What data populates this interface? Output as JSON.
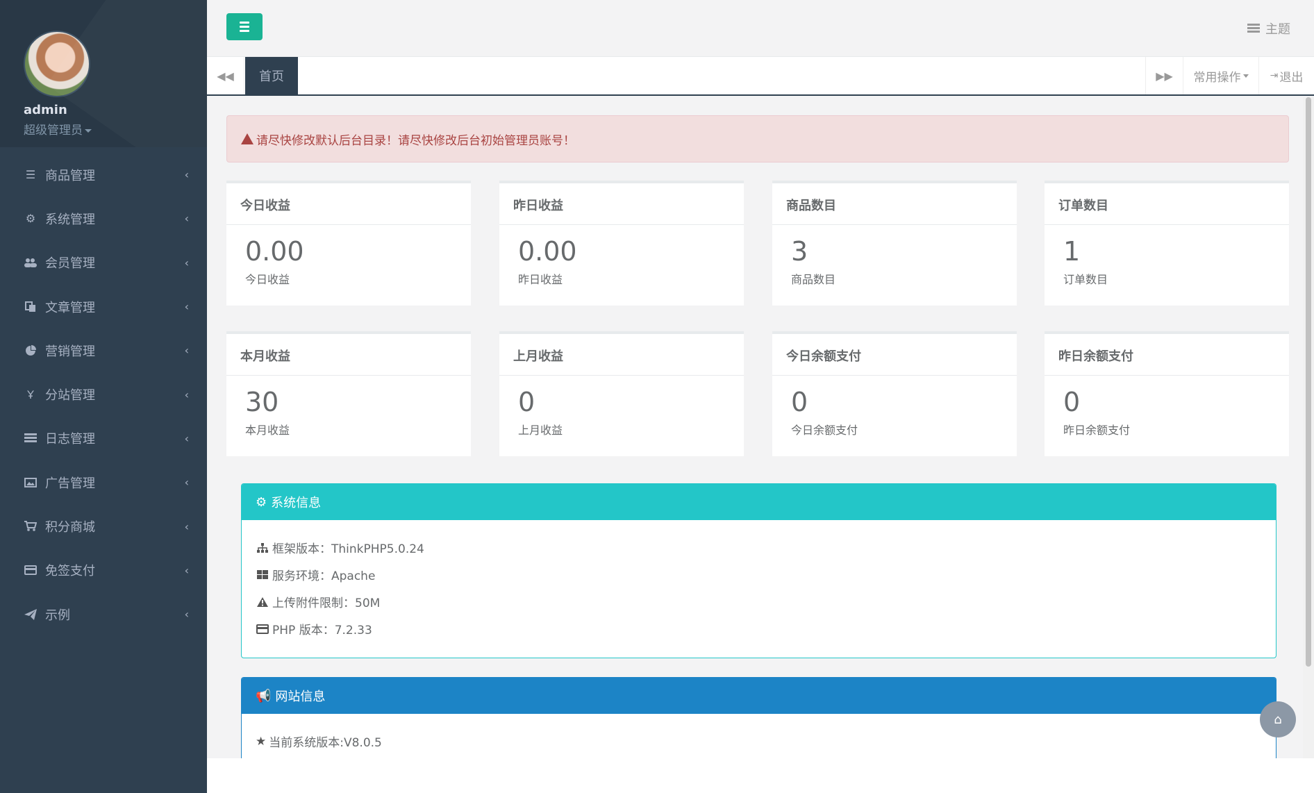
{
  "profile": {
    "name": "admin",
    "role": "超级管理员"
  },
  "sidebar": {
    "items": [
      {
        "label": "商品管理",
        "icon": "list-icon"
      },
      {
        "label": "系统管理",
        "icon": "gear-icon"
      },
      {
        "label": "会员管理",
        "icon": "users-icon"
      },
      {
        "label": "文章管理",
        "icon": "copy-icon"
      },
      {
        "label": "营销管理",
        "icon": "pie-chart-icon"
      },
      {
        "label": "分站管理",
        "icon": "tree-icon"
      },
      {
        "label": "日志管理",
        "icon": "tasks-icon"
      },
      {
        "label": "广告管理",
        "icon": "picture-icon"
      },
      {
        "label": "积分商城",
        "icon": "cart-icon"
      },
      {
        "label": "免签支付",
        "icon": "credit-card-icon"
      },
      {
        "label": "示例",
        "icon": "paper-plane-icon"
      }
    ]
  },
  "topbar": {
    "theme_label": "主题"
  },
  "tabs": {
    "active_label": "首页",
    "ops_label": "常用操作",
    "logout_label": "退出"
  },
  "alert": {
    "text": "请尽快修改默认后台目录！请尽快修改后台初始管理员账号！"
  },
  "stats": [
    {
      "title": "今日收益",
      "value": "0.00",
      "sub": "今日收益"
    },
    {
      "title": "昨日收益",
      "value": "0.00",
      "sub": "昨日收益"
    },
    {
      "title": "商品数目",
      "value": "3",
      "sub": "商品数目"
    },
    {
      "title": "订单数目",
      "value": "1",
      "sub": "订单数目"
    },
    {
      "title": "本月收益",
      "value": "30",
      "sub": "本月收益"
    },
    {
      "title": "上月收益",
      "value": "0",
      "sub": "上月收益"
    },
    {
      "title": "今日余额支付",
      "value": "0",
      "sub": "今日余额支付"
    },
    {
      "title": "昨日余额支付",
      "value": "0",
      "sub": "昨日余额支付"
    }
  ],
  "system_info": {
    "title": "系统信息",
    "rows": [
      {
        "label": "框架版本：ThinkPHP5.0.24"
      },
      {
        "label": "服务环境：Apache"
      },
      {
        "label": "上传附件限制：50M"
      },
      {
        "label": "PHP 版本：7.2.33"
      }
    ]
  },
  "site_info": {
    "title": "网站信息",
    "version": "当前系统版本:V8.0.5"
  },
  "colors": {
    "sidebar_bg": "#2f4050",
    "accent_green": "#1ab394",
    "info_teal": "#23c6c8",
    "primary_blue": "#1c84c6",
    "alert_bg": "#f2dede"
  }
}
